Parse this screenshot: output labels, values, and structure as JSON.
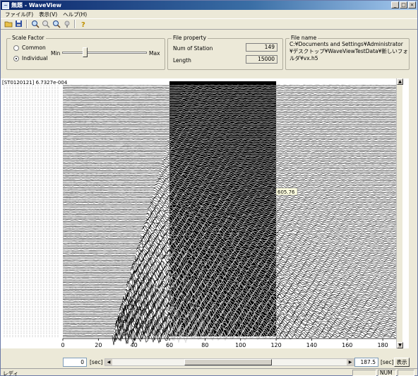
{
  "window": {
    "title": "無題 - WaveView",
    "app_icon": "wave-app-icon"
  },
  "title_controls": {
    "minimize": "_",
    "maximize": "□",
    "close": "×"
  },
  "menu": {
    "file": "ファイル(F)",
    "view": "表示(V)",
    "help": "ヘルプ(H)"
  },
  "toolbar": {
    "icons": [
      "open-folder-icon",
      "save-icon",
      "zoom-in-icon",
      "zoom-icon",
      "zoom-out-icon",
      "pan-icon",
      "help-icon"
    ]
  },
  "scale_factor": {
    "title": "Scale Factor",
    "common_label": "Common",
    "individual_label": "Individual",
    "selected": "Individual",
    "min_label": "Min",
    "max_label": "Max",
    "slider_level": 0.27
  },
  "file_property": {
    "title": "File property",
    "num_station_label": "Num of Station",
    "num_station_value": "149",
    "length_label": "Length",
    "length_value": "15000"
  },
  "file_name": {
    "title": "File name",
    "path": "C:¥Documents and Settings¥Administrator¥デスクトップ¥WaveViewTestData¥新しいフォルダ¥vx.h5"
  },
  "plot": {
    "header_label": "[ST0120121] 6.7327e-004",
    "cursor_readout": "605.76",
    "x_ticks": [
      "0",
      "20",
      "40",
      "60",
      "80",
      "100",
      "120",
      "140",
      "160",
      "180"
    ]
  },
  "chart_data": {
    "type": "line",
    "xlabel": "",
    "ylabel": "",
    "xlim": [
      0,
      187.5
    ],
    "x_ticks": [
      0,
      20,
      40,
      60,
      80,
      100,
      120,
      140,
      160,
      180
    ],
    "num_traces": 149,
    "highlighted_x_range": [
      60,
      120
    ]
  },
  "range": {
    "start_value": "0",
    "start_unit": "[sec]",
    "end_value": "187.5",
    "end_unit": "[sec]",
    "show_button": "表示"
  },
  "status": {
    "text": "レディ",
    "num": "NUM"
  }
}
